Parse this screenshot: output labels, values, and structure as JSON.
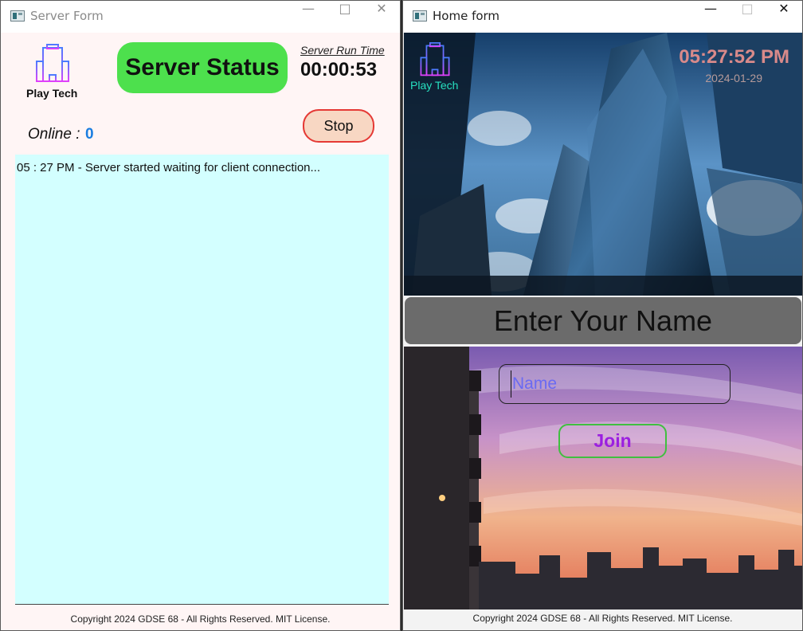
{
  "server_window": {
    "title": "Server Form",
    "brand": "Play Tech",
    "status_label": "Server Status",
    "runtime_label": "Server Run Time",
    "runtime_value": "00:00:53",
    "online_label": "Online :",
    "online_count": "0",
    "stop_label": "Stop",
    "log_lines": [
      "05 : 27 PM - Server started waiting for client connection..."
    ],
    "footer": "Copyright 2024 GDSE 68 - All Rights Reserved. MIT License."
  },
  "home_window": {
    "title": "Home form",
    "brand": "Play Tech",
    "clock": "05:27:52 PM",
    "date": "2024-01-29",
    "banner": "Enter Your Name",
    "name_placeholder": "Name",
    "join_label": "Join",
    "footer": "Copyright 2024 GDSE 68 - All Rights Reserved. MIT License."
  },
  "colors": {
    "status_green": "#4de04d",
    "log_bg": "#d3ffff",
    "online_blue": "#1a7de0",
    "join_purple": "#9b1fe0",
    "clock_pink": "#d98a8a"
  },
  "icons": [
    "app-window-icon",
    "building-icon",
    "minimize-icon",
    "maximize-icon",
    "close-icon"
  ]
}
